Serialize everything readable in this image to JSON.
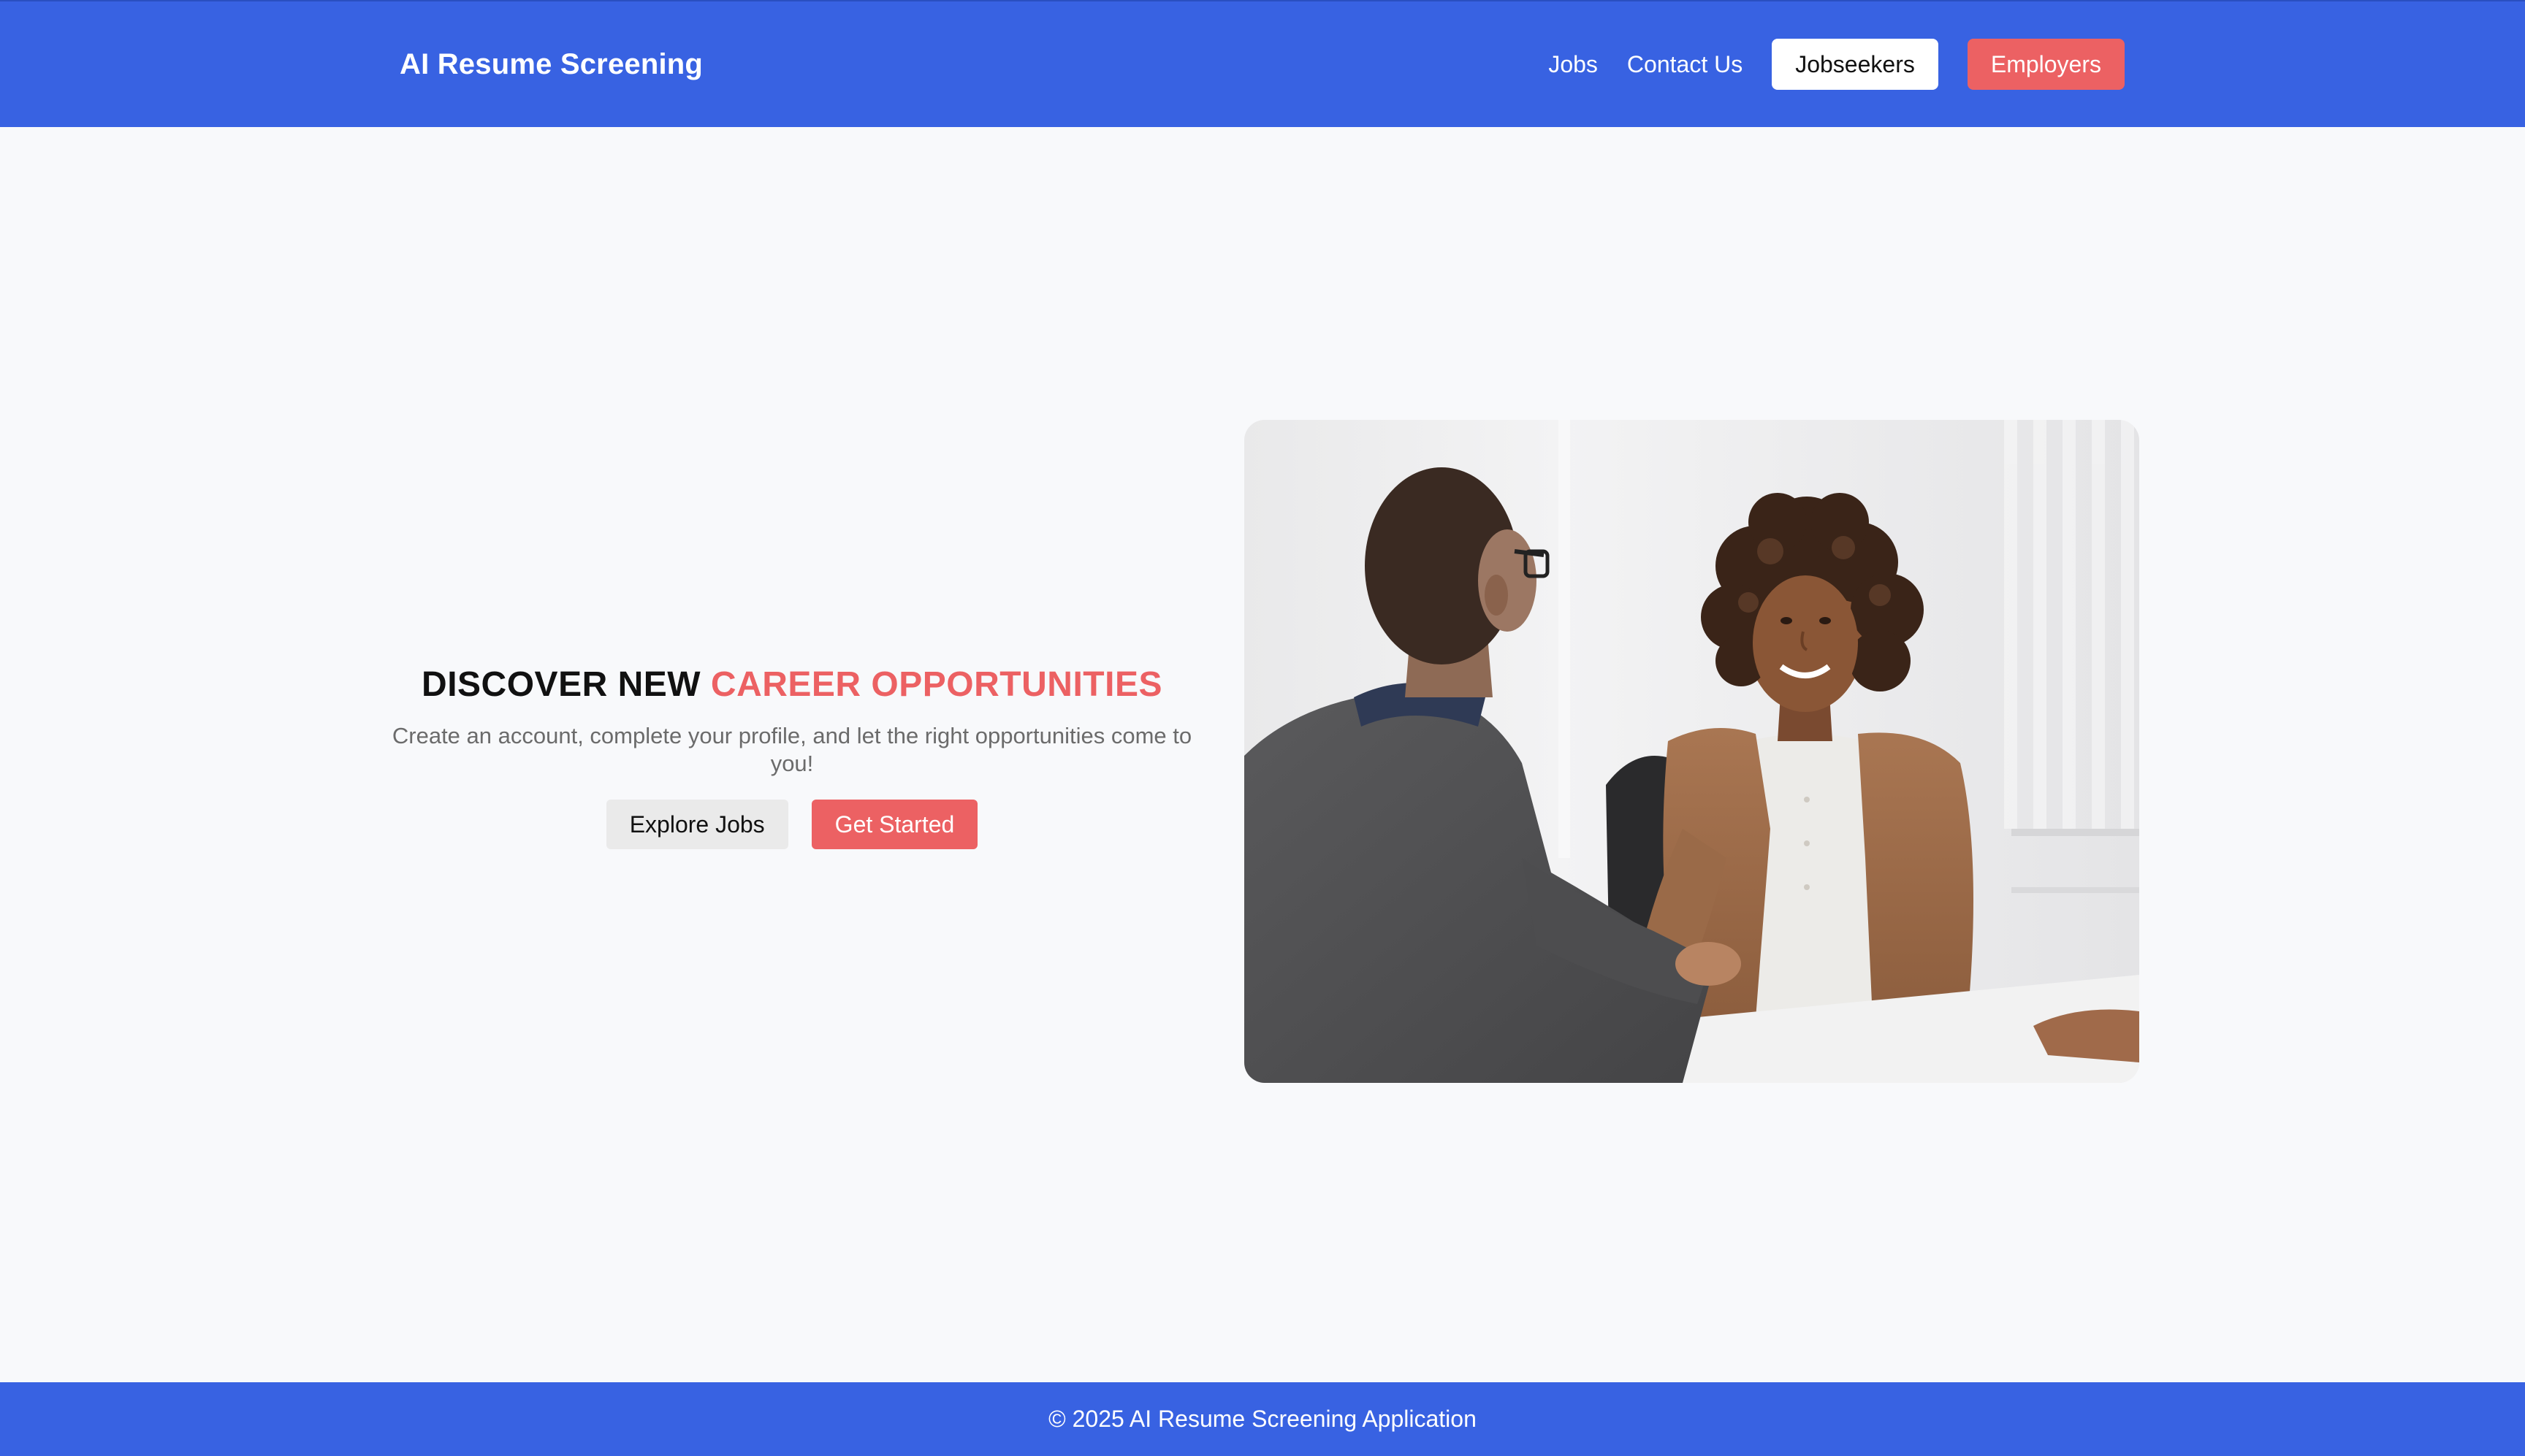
{
  "header": {
    "brand": "AI Resume Screening",
    "nav": {
      "jobs": "Jobs",
      "contact": "Contact Us",
      "jobseekers": "Jobseekers",
      "employers": "Employers"
    }
  },
  "hero": {
    "title_part1": "DISCOVER NEW",
    "title_part2": "CAREER OPPORTUNITIES",
    "subtitle": "Create an account, complete your profile, and let the right opportunities come to you!",
    "explore_label": "Explore Jobs",
    "start_label": "Get Started",
    "image": "handshake-interview-photo"
  },
  "footer": {
    "copyright": "© 2025 AI Resume Screening Application"
  },
  "colors": {
    "brand_blue": "#3862e2",
    "accent_red": "#ec6163",
    "page_bg": "#f8f9fb"
  }
}
